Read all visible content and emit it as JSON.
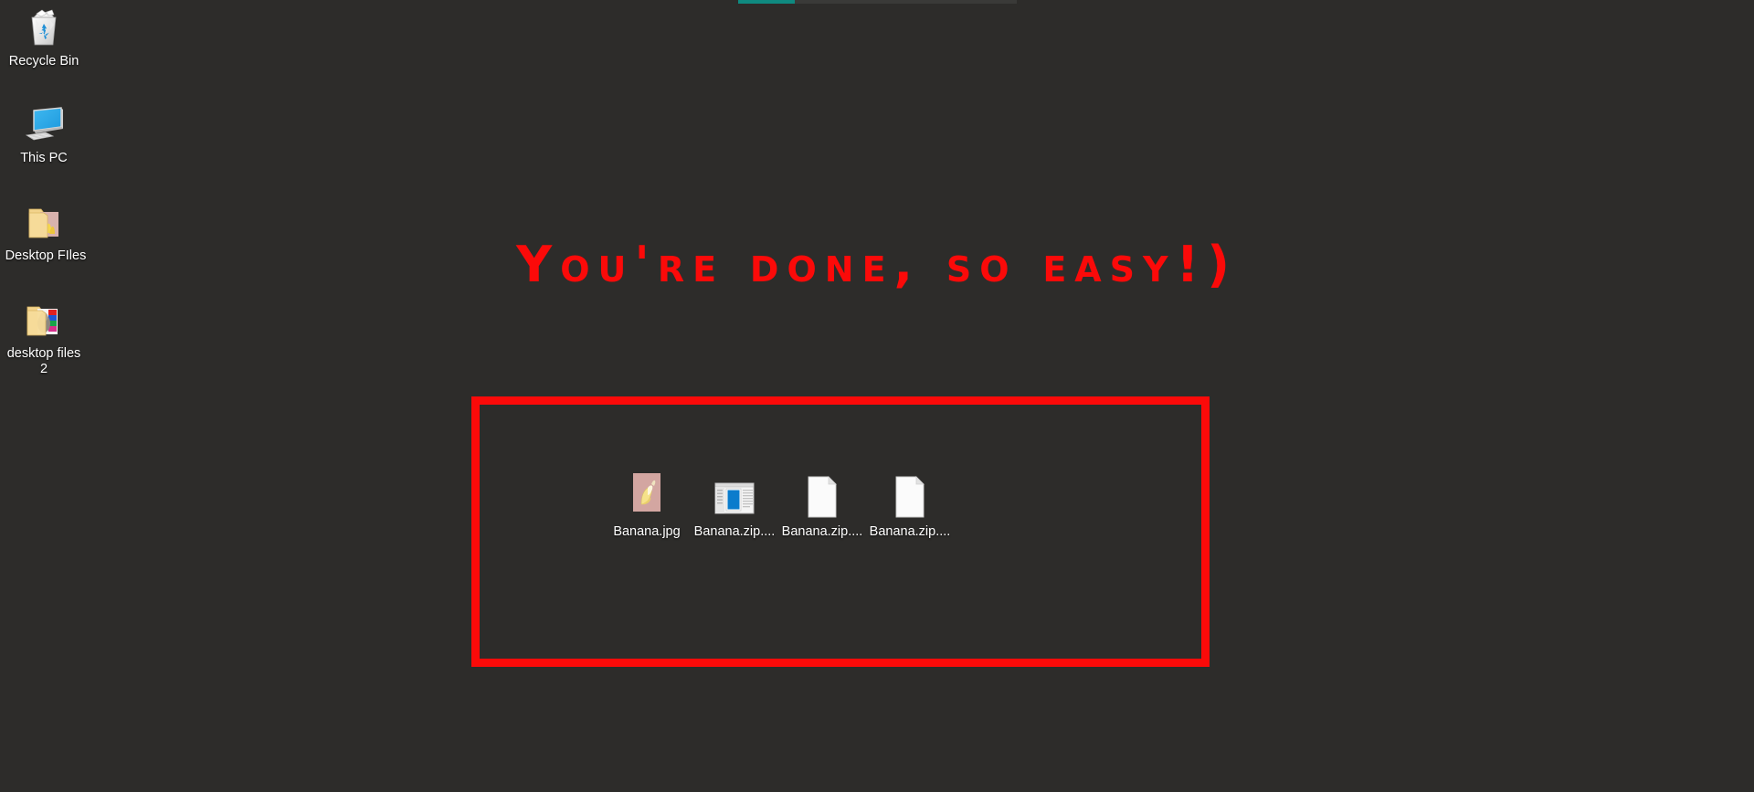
{
  "desktop": {
    "background_color": "#2d2c2a",
    "icons": [
      {
        "label": "Recycle Bin",
        "icon": "recycle-bin-icon"
      },
      {
        "label": "This PC",
        "icon": "this-pc-icon"
      },
      {
        "label": "Desktop FIles",
        "icon": "folder-with-pictures-icon"
      },
      {
        "label": "desktop files 2",
        "icon": "folder-with-pictures-icon"
      }
    ]
  },
  "top_strip": {
    "icon": "progress-bar-sliver",
    "fill_color": "#0f8a80",
    "track_color": "#3a3a38"
  },
  "annotation": {
    "banner_text": "You're done, so easy!)",
    "banner_color": "#fb0a09",
    "box_color": "#fb0a09",
    "box_stroke_px": "9"
  },
  "files": {
    "items": [
      {
        "label": "Banana.jpg",
        "icon": "image-thumbnail-banana"
      },
      {
        "label": "Banana.zip....",
        "icon": "document-preview-window-icon"
      },
      {
        "label": "Banana.zip....",
        "icon": "blank-page-icon"
      },
      {
        "label": "Banana.zip....",
        "icon": "blank-page-icon"
      }
    ]
  }
}
